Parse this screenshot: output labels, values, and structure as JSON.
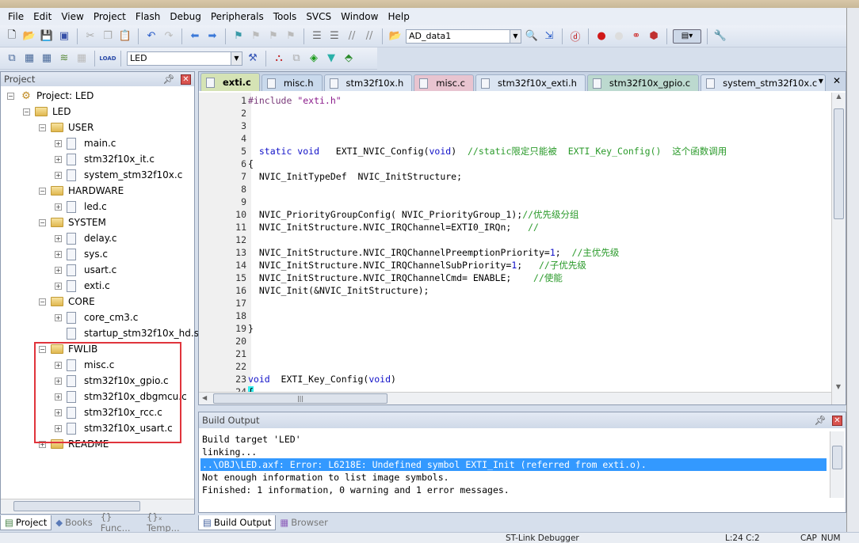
{
  "menu": [
    "File",
    "Edit",
    "View",
    "Project",
    "Flash",
    "Debug",
    "Peripherals",
    "Tools",
    "SVCS",
    "Window",
    "Help"
  ],
  "toolbar": {
    "find_combo": "AD_data1",
    "target_combo": "LED",
    "load_label": "LOAD"
  },
  "project": {
    "title": "Project",
    "tree": [
      {
        "label": "Project: LED",
        "level": 0,
        "kind": "root"
      },
      {
        "label": "LED",
        "level": 1,
        "kind": "target"
      },
      {
        "label": "USER",
        "level": 2,
        "kind": "folder"
      },
      {
        "label": "main.c",
        "level": 3,
        "kind": "file"
      },
      {
        "label": "stm32f10x_it.c",
        "level": 3,
        "kind": "file"
      },
      {
        "label": "system_stm32f10x.c",
        "level": 3,
        "kind": "file"
      },
      {
        "label": "HARDWARE",
        "level": 2,
        "kind": "folder"
      },
      {
        "label": "led.c",
        "level": 3,
        "kind": "file"
      },
      {
        "label": "SYSTEM",
        "level": 2,
        "kind": "folder"
      },
      {
        "label": "delay.c",
        "level": 3,
        "kind": "file"
      },
      {
        "label": "sys.c",
        "level": 3,
        "kind": "file"
      },
      {
        "label": "usart.c",
        "level": 3,
        "kind": "file"
      },
      {
        "label": "exti.c",
        "level": 3,
        "kind": "file"
      },
      {
        "label": "CORE",
        "level": 2,
        "kind": "folder"
      },
      {
        "label": "core_cm3.c",
        "level": 3,
        "kind": "file"
      },
      {
        "label": "startup_stm32f10x_hd.s",
        "level": 3,
        "kind": "file-noexp"
      },
      {
        "label": "FWLIB",
        "level": 2,
        "kind": "folder"
      },
      {
        "label": "misc.c",
        "level": 3,
        "kind": "file"
      },
      {
        "label": "stm32f10x_gpio.c",
        "level": 3,
        "kind": "file"
      },
      {
        "label": "stm32f10x_dbgmcu.c",
        "level": 3,
        "kind": "file"
      },
      {
        "label": "stm32f10x_rcc.c",
        "level": 3,
        "kind": "file"
      },
      {
        "label": "stm32f10x_usart.c",
        "level": 3,
        "kind": "file"
      },
      {
        "label": "README",
        "level": 2,
        "kind": "folder-collapsed"
      }
    ],
    "bottom_tabs": [
      "Project",
      "Books",
      "{} Func...",
      "{}ₓ Temp..."
    ]
  },
  "editor": {
    "tabs": [
      {
        "label": "exti.c",
        "color": "#d5e3b5",
        "active": true
      },
      {
        "label": "misc.h",
        "color": "#c9d9ec"
      },
      {
        "label": "stm32f10x.h",
        "color": "#dbe5f2"
      },
      {
        "label": "misc.c",
        "color": "#e8c4d0"
      },
      {
        "label": "stm32f10x_exti.h",
        "color": "#dbe5f2"
      },
      {
        "label": "stm32f10x_gpio.c",
        "color": "#bcd9cf"
      },
      {
        "label": "system_stm32f10x.c",
        "color": "#dbe5f2"
      }
    ],
    "lines": [
      {
        "n": "1",
        "segs": [
          {
            "t": "#include ",
            "c": "p"
          },
          {
            "t": "\"exti.h\"",
            "c": "s"
          }
        ]
      },
      {
        "n": "2",
        "segs": []
      },
      {
        "n": "3",
        "segs": []
      },
      {
        "n": "4",
        "segs": []
      },
      {
        "n": "5",
        "segs": [
          {
            "t": "  static void",
            "c": "k"
          },
          {
            "t": "   EXTI_NVIC_Config(",
            "c": "t"
          },
          {
            "t": "void",
            "c": "k"
          },
          {
            "t": ")  ",
            "c": "t"
          },
          {
            "t": "//static限定只能被  EXTI_Key_Config()  这个函数调用",
            "c": "c"
          }
        ]
      },
      {
        "n": "6",
        "segs": [
          {
            "t": "{",
            "c": "t"
          }
        ]
      },
      {
        "n": "7",
        "segs": [
          {
            "t": "  NVIC_InitTypeDef  NVIC_InitStructure;",
            "c": "t"
          }
        ]
      },
      {
        "n": "8",
        "segs": []
      },
      {
        "n": "9",
        "segs": []
      },
      {
        "n": "10",
        "segs": [
          {
            "t": "  NVIC_PriorityGroupConfig( NVIC_PriorityGroup_1);",
            "c": "t"
          },
          {
            "t": "//优先级分组",
            "c": "c"
          }
        ]
      },
      {
        "n": "11",
        "segs": [
          {
            "t": "  NVIC_InitStructure.NVIC_IRQChannel=EXTI0_IRQn;   ",
            "c": "t"
          },
          {
            "t": "//",
            "c": "c"
          }
        ]
      },
      {
        "n": "12",
        "segs": []
      },
      {
        "n": "13",
        "segs": [
          {
            "t": "  NVIC_InitStructure.NVIC_IRQChannelPreemptionPriority=",
            "c": "t"
          },
          {
            "t": "1",
            "c": "k"
          },
          {
            "t": ";  ",
            "c": "t"
          },
          {
            "t": "//主优先级",
            "c": "c"
          }
        ]
      },
      {
        "n": "14",
        "segs": [
          {
            "t": "  NVIC_InitStructure.NVIC_IRQChannelSubPriority=",
            "c": "t"
          },
          {
            "t": "1",
            "c": "k"
          },
          {
            "t": ";   ",
            "c": "t"
          },
          {
            "t": "//子优先级",
            "c": "c"
          }
        ]
      },
      {
        "n": "15",
        "segs": [
          {
            "t": "  NVIC_InitStructure.NVIC_IRQChannelCmd= ENABLE;    ",
            "c": "t"
          },
          {
            "t": "//使能",
            "c": "c"
          }
        ]
      },
      {
        "n": "16",
        "segs": [
          {
            "t": "  NVIC_Init(&NVIC_InitStructure);",
            "c": "t"
          }
        ]
      },
      {
        "n": "17",
        "segs": []
      },
      {
        "n": "18",
        "segs": []
      },
      {
        "n": "19",
        "segs": [
          {
            "t": "}",
            "c": "t"
          }
        ]
      },
      {
        "n": "20",
        "segs": []
      },
      {
        "n": "21",
        "segs": []
      },
      {
        "n": "22",
        "segs": []
      },
      {
        "n": "23",
        "segs": [
          {
            "t": "void",
            "c": "k"
          },
          {
            "t": "  EXTI_Key_Config(",
            "c": "t"
          },
          {
            "t": "void",
            "c": "k"
          },
          {
            "t": ")",
            "c": "t"
          }
        ]
      },
      {
        "n": "24",
        "segs": [
          {
            "t": "{",
            "c": "cur"
          }
        ]
      }
    ]
  },
  "build": {
    "title": "Build Output",
    "lines": [
      {
        "text": "Build target 'LED'"
      },
      {
        "text": "linking..."
      },
      {
        "text": "..\\OBJ\\LED.axf: Error: L6218E: Undefined symbol EXTI_Init (referred from exti.o).",
        "selected": true
      },
      {
        "text": "Not enough information to list image symbols."
      },
      {
        "text": "Finished: 1 information, 0 warning and 1 error messages."
      }
    ],
    "bottom_tabs": [
      "Build Output",
      "Browser"
    ]
  },
  "status": {
    "debugger": "ST-Link Debugger",
    "position": "L:24 C:2",
    "caps": "CAP",
    "num": "NUM"
  },
  "highlight_color": "#e0343c"
}
